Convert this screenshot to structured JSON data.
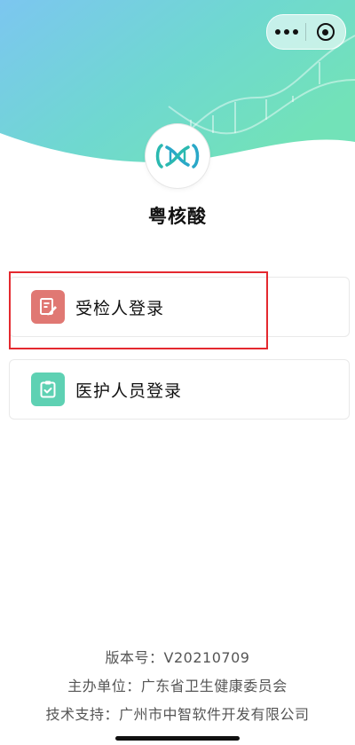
{
  "app": {
    "name": "粤核酸"
  },
  "options": [
    {
      "label": "受检人登录",
      "icon": "document-edit-icon",
      "color": "#e07873"
    },
    {
      "label": "医护人员登录",
      "icon": "clipboard-check-icon",
      "color": "#5ed1b3"
    }
  ],
  "footer": {
    "version": "版本号：V20210709",
    "organizer": "主办单位：广东省卫生健康委员会",
    "support": "技术支持：广州市中智软件开发有限公司"
  },
  "colors": {
    "highlight": "#e4292f",
    "header_start": "#7cc6f0",
    "header_end": "#6fe0c0"
  }
}
